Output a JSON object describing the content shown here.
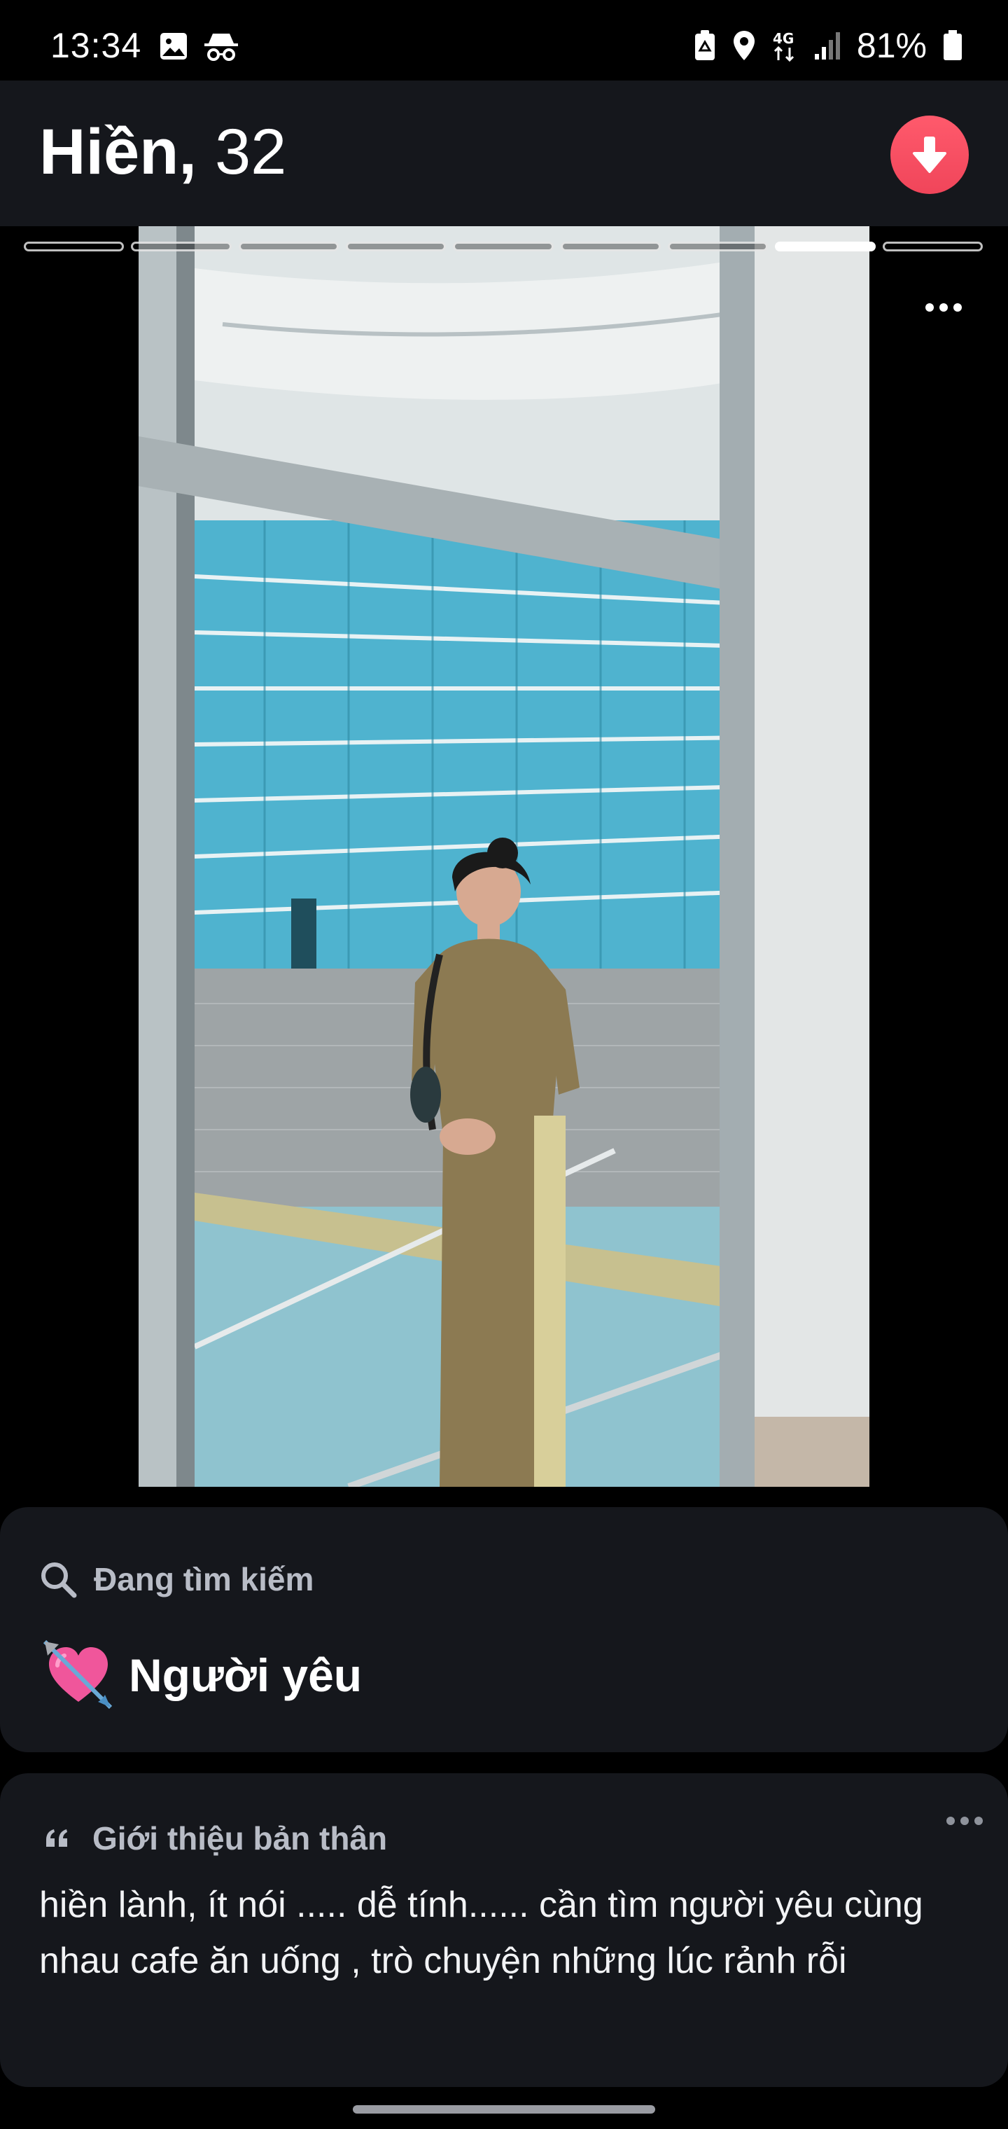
{
  "status_bar": {
    "time": "13:34",
    "network": "4G",
    "battery": "81%",
    "icons": [
      "gallery-icon",
      "incognito-icon",
      "recycle-battery-icon",
      "location-icon",
      "network-4g-icon",
      "signal-icon",
      "battery-icon"
    ]
  },
  "profile": {
    "name": "Hiền,",
    "age": "32",
    "collapse_icon": "arrow-down-icon",
    "accent_color": "#f0455a"
  },
  "photos": {
    "count": 9,
    "active_index": 7,
    "more_icon": "more-horizontal-icon"
  },
  "looking_for": {
    "heading": "Đang tìm kiếm",
    "value": "Người yêu",
    "emoji": "💘"
  },
  "bio": {
    "heading": "Giới thiệu bản thân",
    "text": "hiền lành, ít nói ..... dễ tính......  cần tìm người yêu cùng nhau cafe ăn uống , trò chuyện những lúc rảnh rỗi"
  }
}
